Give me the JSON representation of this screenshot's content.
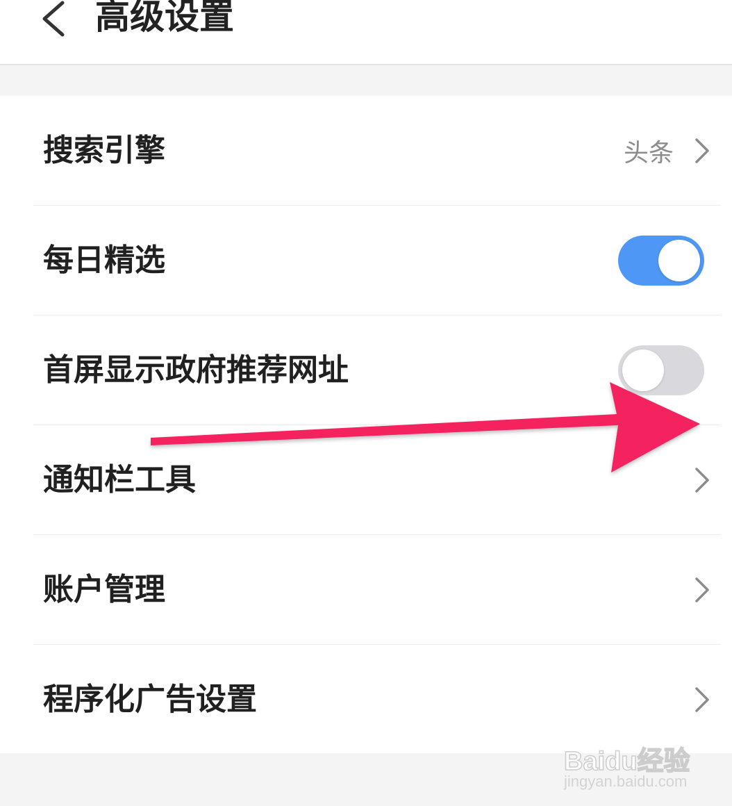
{
  "header": {
    "title": "高级设置",
    "back_icon": "chevron-left-icon"
  },
  "settings": [
    {
      "label": "搜索引擎",
      "value": "头条",
      "control": "chevron"
    },
    {
      "label": "每日精选",
      "control": "toggle",
      "toggle_on": true
    },
    {
      "label": "首屏显示政府推荐网址",
      "control": "toggle",
      "toggle_on": false
    },
    {
      "label": "通知栏工具",
      "control": "chevron"
    },
    {
      "label": "账户管理",
      "control": "chevron"
    },
    {
      "label": "程序化广告设置",
      "control": "chevron"
    }
  ],
  "annotation": {
    "arrow_color": "#f4205e"
  },
  "watermark": {
    "brand": "Baidu经验",
    "url": "jingyan.baidu.com"
  },
  "colors": {
    "toggle_on": "#4e97f5",
    "toggle_off": "#d9d8dc",
    "section_gap": "#f4f4f4",
    "secondary_text": "#8c8c8c"
  }
}
